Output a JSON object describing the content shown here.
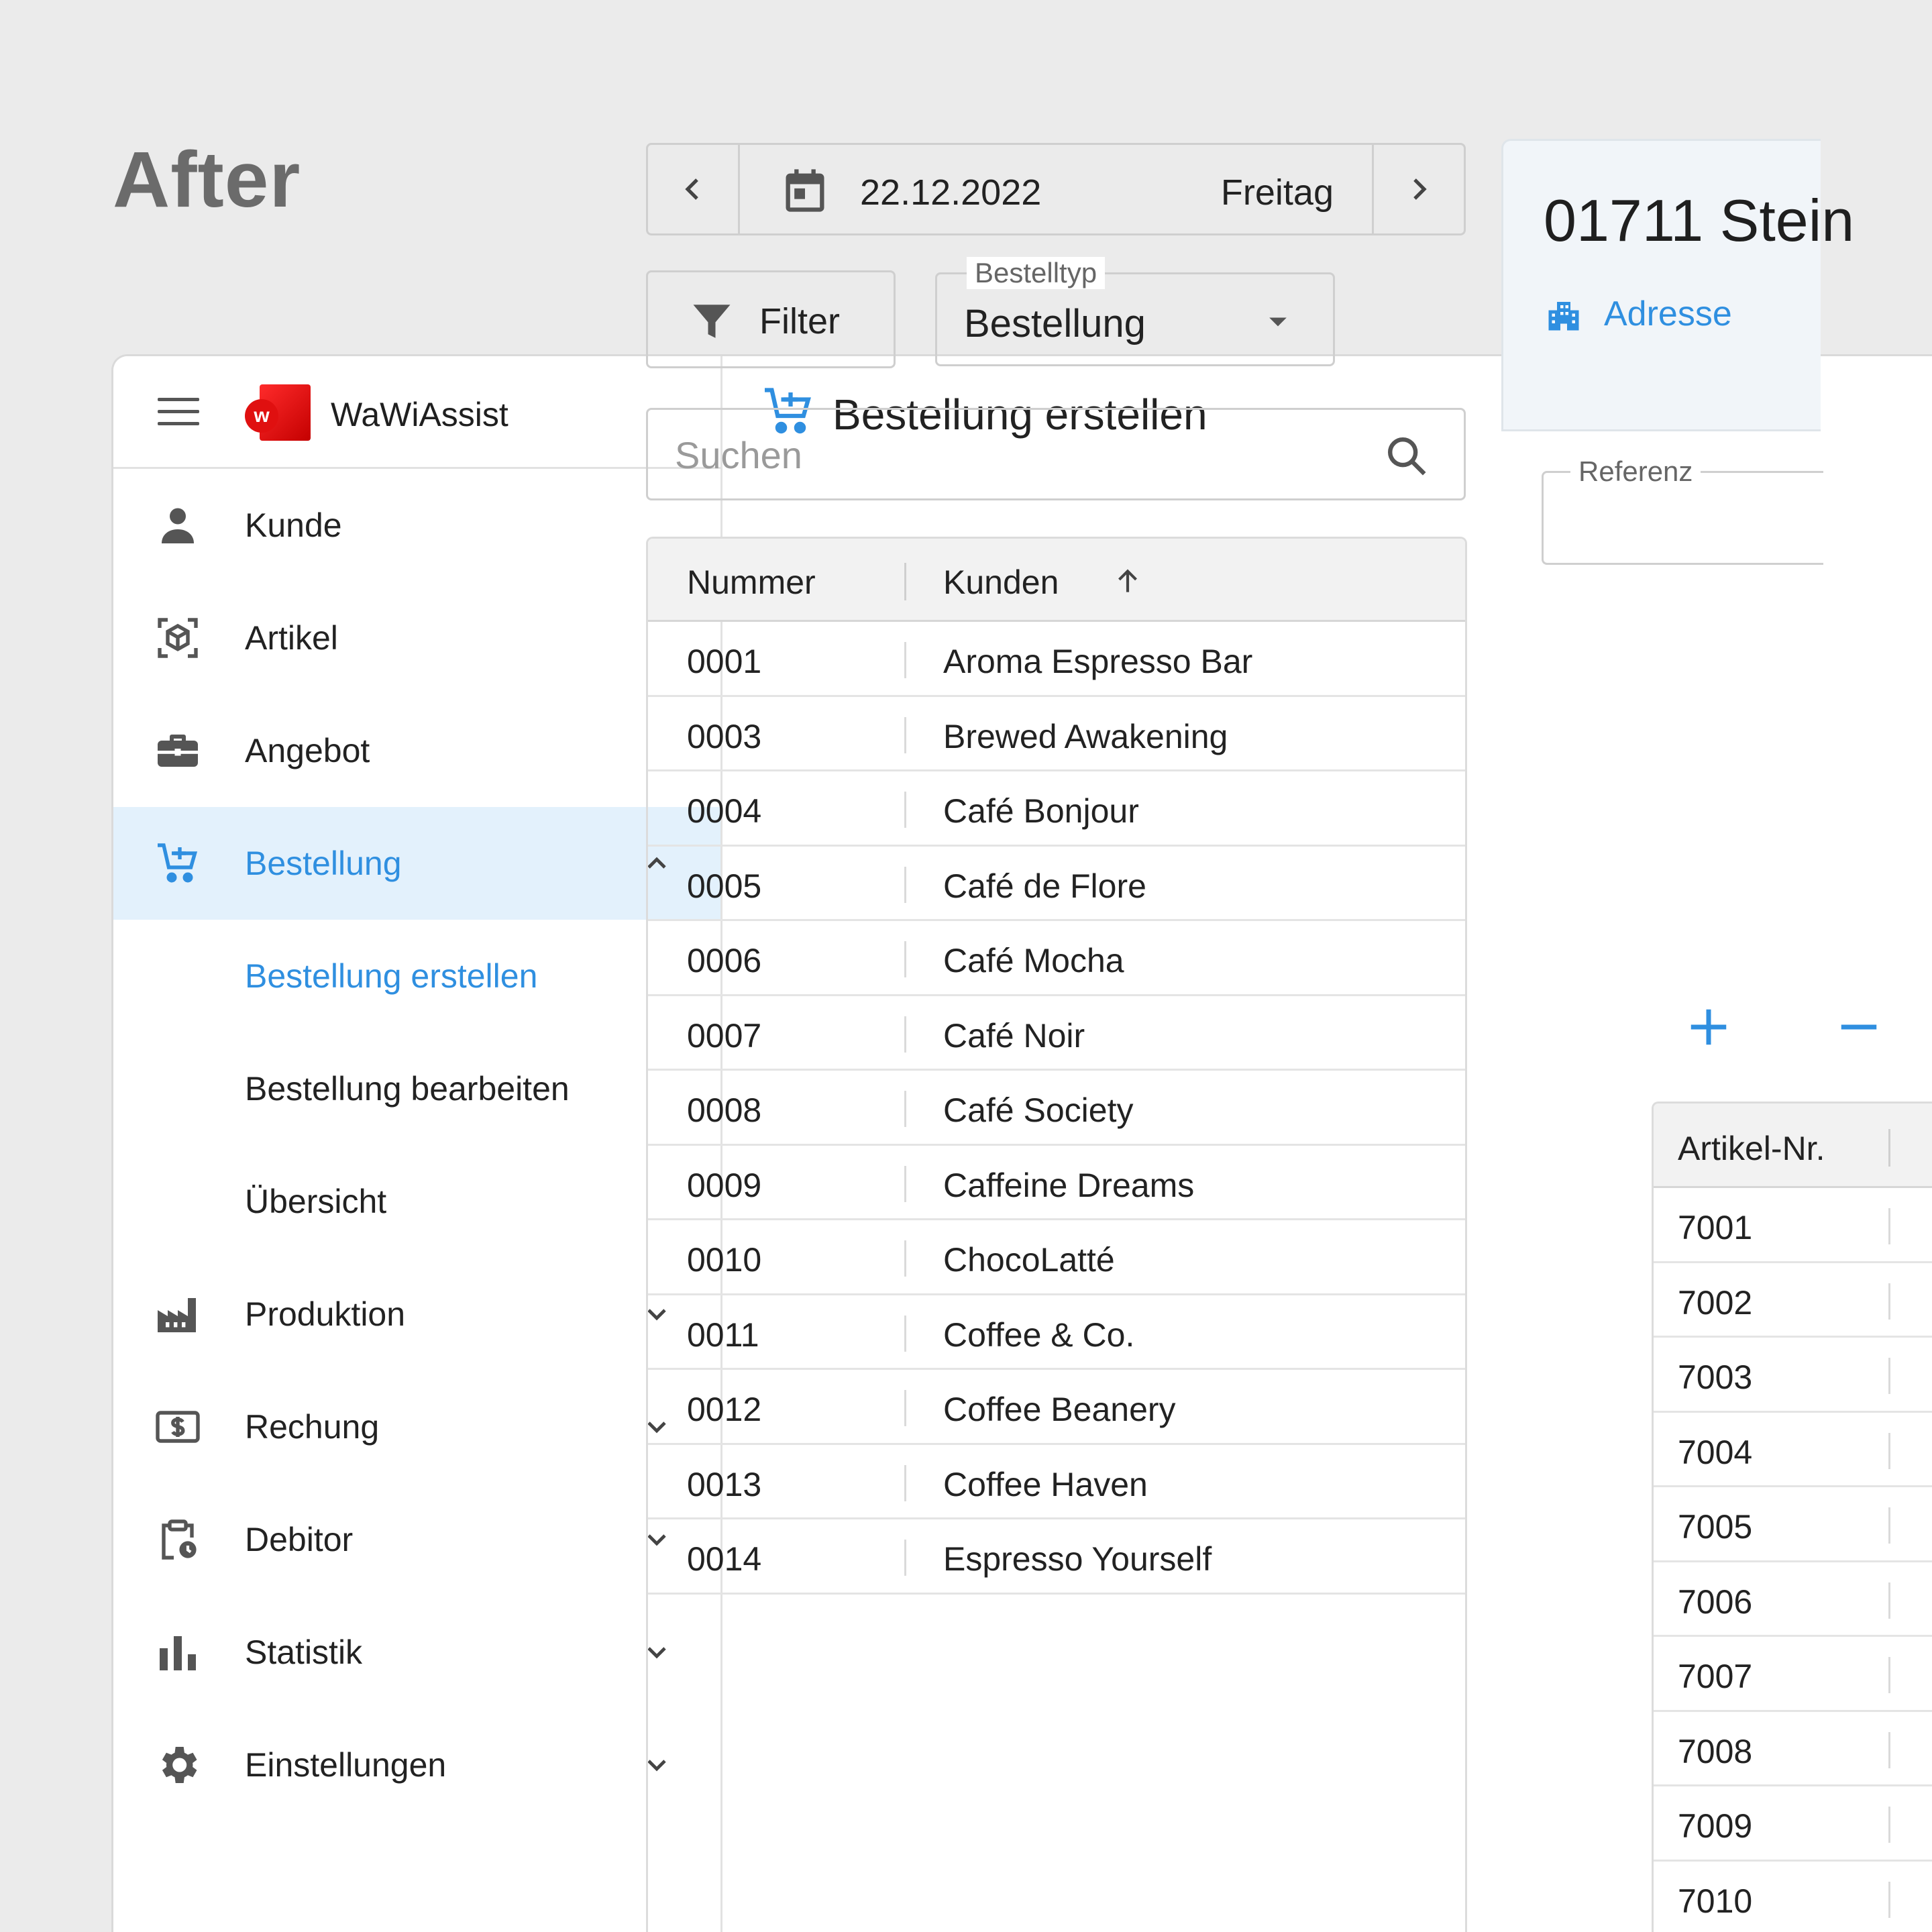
{
  "page": {
    "heading": "After"
  },
  "sidebar": {
    "brand": "WaWiAssist",
    "logo_letter": "w",
    "items": [
      {
        "label": "Kunde",
        "icon": "person-icon"
      },
      {
        "label": "Artikel",
        "icon": "cube-scan-icon"
      },
      {
        "label": "Angebot",
        "icon": "briefcase-icon"
      },
      {
        "label": "Bestellung",
        "icon": "cart-plus-icon",
        "active": true,
        "expanded": true
      },
      {
        "label": "Produktion",
        "icon": "factory-icon"
      },
      {
        "label": "Rechung",
        "icon": "dollar-bill-icon"
      },
      {
        "label": "Debitor",
        "icon": "clipboard-clock-icon"
      },
      {
        "label": "Statistik",
        "icon": "bar-chart-icon"
      },
      {
        "label": "Einstellungen",
        "icon": "gear-icon"
      }
    ],
    "sub_items": [
      {
        "label": "Bestellung erstellen",
        "active": true
      },
      {
        "label": "Bestellung bearbeiten"
      },
      {
        "label": "Übersicht"
      }
    ]
  },
  "header": {
    "title": "Bestellung erstellen"
  },
  "datebar": {
    "date": "22.12.2022",
    "day": "Freitag"
  },
  "filter": {
    "label": "Filter"
  },
  "bestelltyp": {
    "legend": "Bestelltyp",
    "value": "Bestellung"
  },
  "search": {
    "placeholder": "Suchen"
  },
  "customers": {
    "headers": {
      "number": "Nummer",
      "customer": "Kunden"
    },
    "rows": [
      {
        "number": "0001",
        "name": "Aroma Espresso Bar"
      },
      {
        "number": "0003",
        "name": "Brewed Awakening"
      },
      {
        "number": "0004",
        "name": "Café Bonjour"
      },
      {
        "number": "0005",
        "name": "Café de Flore"
      },
      {
        "number": "0006",
        "name": "Café Mocha"
      },
      {
        "number": "0007",
        "name": "Café Noir"
      },
      {
        "number": "0008",
        "name": "Café Society"
      },
      {
        "number": "0009",
        "name": "Caffeine Dreams"
      },
      {
        "number": "0010",
        "name": "ChocoLatté"
      },
      {
        "number": "0011",
        "name": "Coffee & Co."
      },
      {
        "number": "0012",
        "name": "Coffee Beanery"
      },
      {
        "number": "0013",
        "name": "Coffee Haven"
      },
      {
        "number": "0014",
        "name": "Espresso Yourself"
      }
    ]
  },
  "right_panel": {
    "title": "01711 Stein",
    "address_label": "Adresse",
    "reference_legend": "Referenz",
    "articles": {
      "header": "Artikel-Nr.",
      "rows": [
        "7001",
        "7002",
        "7003",
        "7004",
        "7005",
        "7006",
        "7007",
        "7008",
        "7009",
        "7010"
      ]
    }
  },
  "colors": {
    "accent": "#2f8fe0",
    "active_bg": "#e3f1fc",
    "brand_red": "#e01010"
  }
}
